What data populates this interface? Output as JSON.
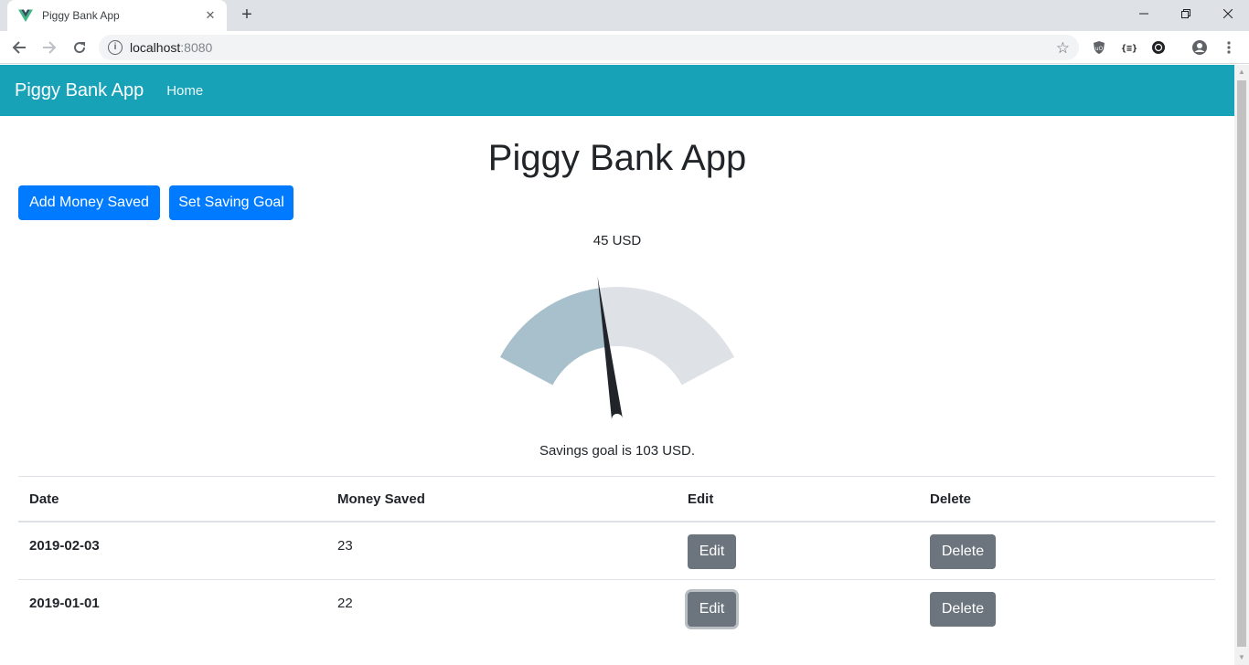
{
  "browser": {
    "tab_title": "Piggy Bank App",
    "url_host": "localhost",
    "url_port": ":8080"
  },
  "navbar": {
    "brand": "Piggy Bank App",
    "home_link": "Home",
    "color": "#17a2b8"
  },
  "main": {
    "title": "Piggy Bank App",
    "add_money_button": "Add Money Saved",
    "set_goal_button": "Set Saving Goal"
  },
  "gauge": {
    "value_label": "45 USD",
    "goal_label": "Savings goal is 103 USD.",
    "value": 45,
    "max": 103,
    "filled_color": "#a7c0cb",
    "remaining_color": "#dee2e6",
    "needle_color": "#212529"
  },
  "table": {
    "headers": {
      "date": "Date",
      "money_saved": "Money Saved",
      "edit": "Edit",
      "delete": "Delete"
    },
    "rows": [
      {
        "date": "2019-02-03",
        "amount": "23",
        "edit": "Edit",
        "delete": "Delete"
      },
      {
        "date": "2019-01-01",
        "amount": "22",
        "edit": "Edit",
        "delete": "Delete"
      }
    ]
  },
  "colors": {
    "primary": "#007bff",
    "secondary": "#6c757d"
  }
}
